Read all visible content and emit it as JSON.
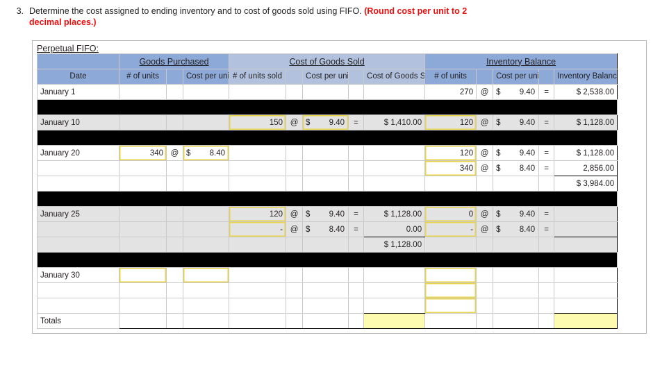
{
  "question": {
    "number": "3.",
    "text": "Determine the cost assigned to ending inventory and to cost of goods sold using FIFO.",
    "emphasis": "(Round cost per unit to 2 decimal places.)"
  },
  "sheet": {
    "title": "Perpetual FIFO:",
    "groups": {
      "blank": "",
      "goods_purchased": "Goods Purchased",
      "cost_of_goods_sold": "Cost of Goods Sold",
      "inventory_balance": "Inventory Balance"
    },
    "subheaders": {
      "date": "Date",
      "gp_units": "# of units",
      "gp_at": "",
      "gp_cost": "Cost per unit",
      "cogs_units": "# of units sold",
      "cogs_at": "",
      "cogs_cost": "Cost per unit",
      "cogs_eq": "",
      "cogs_total": "Cost of Goods Sold",
      "inv_units": "# of units",
      "inv_at": "",
      "inv_cost": "Cost per unit",
      "inv_eq": "",
      "inv_total": "Inventory Balance"
    },
    "symbols": {
      "at": "@",
      "eq": "=",
      "dollar": "$",
      "dash": "-"
    },
    "rows": [
      {
        "date": "January 1",
        "gp_units": "",
        "gp_cost": "",
        "cogs_units": "",
        "cogs_cost": "",
        "cogs_total": "",
        "inv_units": "270",
        "inv_cost": "9.40",
        "inv_total": "$ 2,538.00"
      },
      {
        "date": "January 10",
        "gp_units": "",
        "gp_cost": "",
        "cogs_units": "150",
        "cogs_cost": "9.40",
        "cogs_total": "$  1,410.00",
        "inv_units": "120",
        "inv_cost": "9.40",
        "inv_total": "$ 1,128.00"
      },
      {
        "date": "January 20",
        "gp_units": "340",
        "gp_cost": "8.40",
        "cogs_units": "",
        "cogs_cost": "",
        "cogs_total": "",
        "inv_units": "120",
        "inv_cost": "9.40",
        "inv_total": "$ 1,128.00"
      },
      {
        "date": "",
        "gp_units": "",
        "gp_cost": "",
        "cogs_units": "",
        "cogs_cost": "",
        "cogs_total": "",
        "inv_units": "340",
        "inv_cost": "8.40",
        "inv_total": "2,856.00"
      },
      {
        "date": "",
        "gp_units": "",
        "gp_cost": "",
        "cogs_units": "",
        "cogs_cost": "",
        "cogs_total": "",
        "inv_units": "",
        "inv_cost": "",
        "inv_total": "$ 3,984.00"
      },
      {
        "date": "January 25",
        "gp_units": "",
        "gp_cost": "",
        "cogs_units": "120",
        "cogs_cost": "9.40",
        "cogs_total": "$  1,128.00",
        "inv_units": "0",
        "inv_cost": "9.40",
        "inv_total": ""
      },
      {
        "date": "",
        "gp_units": "",
        "gp_cost": "",
        "cogs_units": "-",
        "cogs_cost": "8.40",
        "cogs_total": "0.00",
        "inv_units": "-",
        "inv_cost": "8.40",
        "inv_total": ""
      },
      {
        "date": "",
        "gp_units": "",
        "gp_cost": "",
        "cogs_units": "",
        "cogs_cost": "",
        "cogs_total": "$  1,128.00",
        "inv_units": "",
        "inv_cost": "",
        "inv_total": ""
      },
      {
        "date": "January 30",
        "gp_units": "",
        "gp_cost": "",
        "cogs_units": "",
        "cogs_cost": "",
        "cogs_total": "",
        "inv_units": "",
        "inv_cost": "",
        "inv_total": ""
      },
      {
        "date": "",
        "gp_units": "",
        "gp_cost": "",
        "cogs_units": "",
        "cogs_cost": "",
        "cogs_total": "",
        "inv_units": "",
        "inv_cost": "",
        "inv_total": ""
      },
      {
        "date": "",
        "gp_units": "",
        "gp_cost": "",
        "cogs_units": "",
        "cogs_cost": "",
        "cogs_total": "",
        "inv_units": "",
        "inv_cost": "",
        "inv_total": ""
      },
      {
        "date": "Totals",
        "gp_units": "",
        "gp_cost": "",
        "cogs_units": "",
        "cogs_cost": "",
        "cogs_total": "",
        "inv_units": "",
        "inv_cost": "",
        "inv_total": ""
      }
    ]
  }
}
